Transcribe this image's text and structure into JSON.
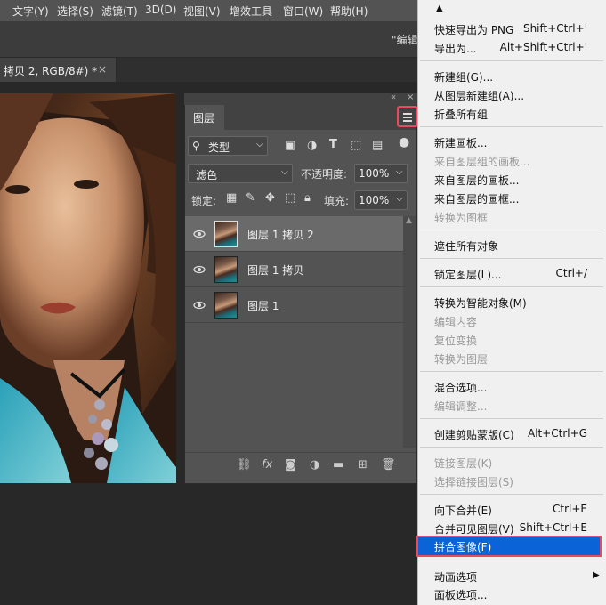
{
  "menubar": {
    "items": [
      "文字(Y)",
      "选择(S)",
      "滤镜(T)",
      "3D(D)",
      "视图(V)",
      "增效工具",
      "窗口(W)",
      "帮助(H)"
    ]
  },
  "options_bar": {
    "hint": "\"编辑"
  },
  "document_tab": {
    "title": "拷贝 2, RGB/8#) *",
    "close": "×"
  },
  "layers_panel": {
    "tab_label": "图层",
    "filter_kind": "类型",
    "blend_mode": "滤色",
    "opacity_label": "不透明度:",
    "opacity_value": "100%",
    "lock_label": "锁定:",
    "fill_label": "填充:",
    "fill_value": "100%",
    "layers": [
      {
        "name": "图层 1 拷贝 2",
        "selected": true
      },
      {
        "name": "图层 1 拷贝",
        "selected": false
      },
      {
        "name": "图层 1",
        "selected": false
      }
    ],
    "bottom_fx": "fx"
  },
  "context_menu": {
    "items": [
      {
        "label": "快速导出为 PNG",
        "shortcut": "Shift+Ctrl+'",
        "disabled": false
      },
      {
        "label": "导出为...",
        "shortcut": "Alt+Shift+Ctrl+'",
        "disabled": false
      },
      {
        "label": "新建组(G)...",
        "shortcut": "",
        "disabled": false
      },
      {
        "label": "从图层新建组(A)...",
        "shortcut": "",
        "disabled": false
      },
      {
        "label": "折叠所有组",
        "shortcut": "",
        "disabled": false
      },
      {
        "label": "新建画板...",
        "shortcut": "",
        "disabled": false
      },
      {
        "label": "来自图层组的画板...",
        "shortcut": "",
        "disabled": true
      },
      {
        "label": "来自图层的画板...",
        "shortcut": "",
        "disabled": false
      },
      {
        "label": "来自图层的画框...",
        "shortcut": "",
        "disabled": false
      },
      {
        "label": "转换为图框",
        "shortcut": "",
        "disabled": true
      },
      {
        "label": "遮住所有对象",
        "shortcut": "",
        "disabled": false
      },
      {
        "label": "锁定图层(L)...",
        "shortcut": "Ctrl+/",
        "disabled": false
      },
      {
        "label": "转换为智能对象(M)",
        "shortcut": "",
        "disabled": false
      },
      {
        "label": "编辑内容",
        "shortcut": "",
        "disabled": true
      },
      {
        "label": "复位变换",
        "shortcut": "",
        "disabled": true
      },
      {
        "label": "转换为图层",
        "shortcut": "",
        "disabled": true
      },
      {
        "label": "混合选项...",
        "shortcut": "",
        "disabled": false
      },
      {
        "label": "编辑调整...",
        "shortcut": "",
        "disabled": true
      },
      {
        "label": "创建剪贴蒙版(C)",
        "shortcut": "Alt+Ctrl+G",
        "disabled": false
      },
      {
        "label": "链接图层(K)",
        "shortcut": "",
        "disabled": true
      },
      {
        "label": "选择链接图层(S)",
        "shortcut": "",
        "disabled": true
      },
      {
        "label": "向下合并(E)",
        "shortcut": "Ctrl+E",
        "disabled": false
      },
      {
        "label": "合并可见图层(V)",
        "shortcut": "Shift+Ctrl+E",
        "disabled": false
      },
      {
        "label": "拼合图像(F)",
        "shortcut": "",
        "disabled": false,
        "highlighted": true
      },
      {
        "label": "动画选项",
        "shortcut": "",
        "disabled": false,
        "submenu": true
      },
      {
        "label": "面板选项...",
        "shortcut": "",
        "disabled": false
      }
    ]
  },
  "colors": {
    "highlight": "#0a64d8",
    "callout": "#e84a5f"
  },
  "icons": [
    "eye-icon",
    "panel-menu-icon",
    "search-icon",
    "link-icon",
    "mask-icon",
    "adjustment-icon",
    "folder-icon",
    "new-layer-icon",
    "trash-icon",
    "submenu-arrow-icon",
    "scroll-up-icon"
  ]
}
